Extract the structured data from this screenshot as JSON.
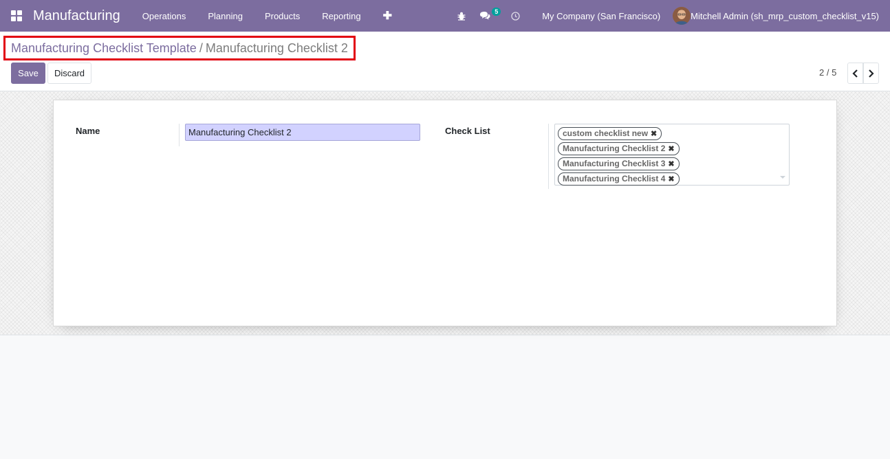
{
  "navbar": {
    "app_name": "Manufacturing",
    "menu": [
      "Operations",
      "Planning",
      "Products",
      "Reporting"
    ],
    "messages_count": "5",
    "company": "My Company (San Francisco)",
    "user": "Mitchell Admin (sh_mrp_custom_checklist_v15)"
  },
  "breadcrumb": {
    "parent": "Manufacturing Checklist Template",
    "separator": "/",
    "current": "Manufacturing Checklist 2"
  },
  "actions": {
    "save_label": "Save",
    "discard_label": "Discard"
  },
  "pager": {
    "value": "2 / 5"
  },
  "form": {
    "name_label": "Name",
    "name_value": "Manufacturing Checklist 2",
    "checklist_label": "Check List",
    "checklist_tags": [
      "custom checklist new",
      "Manufacturing Checklist 2",
      "Manufacturing Checklist 3",
      "Manufacturing Checklist 4"
    ]
  },
  "colors": {
    "navbar": "#7c6d9f",
    "highlight_border": "#e2000f",
    "badge": "#00a09d",
    "input_bg": "#d2d2ff"
  }
}
